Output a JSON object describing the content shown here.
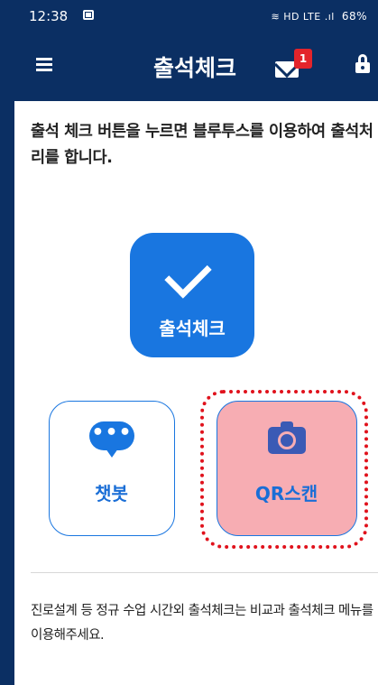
{
  "status_bar": {
    "time": "12:38",
    "network": "≋ HD LTE .ıl",
    "battery": "68%"
  },
  "app_bar": {
    "title": "출석체크",
    "mail_badge": "1"
  },
  "main": {
    "intro_text": "출석 체크 버튼을 누르면 블루투스를 이용하여 출석처리를 합니다.",
    "checkin_label": "출석체크",
    "chatbot_label": "챗봇",
    "chat_dots": "•••",
    "qr_label": "QR스캔",
    "footer_note": "진로설계 등 정규 수업 시간외 출석체크는 비교과 출석체크 메뉴를 이용해주세요."
  },
  "colors": {
    "header_bg": "#0b2f63",
    "accent_blue": "#1976e0",
    "qr_highlight_fill": "#f7adb3",
    "highlight_border": "#e0121c",
    "badge_red": "#e3242b"
  },
  "icons": [
    "menu-icon",
    "mail-icon",
    "lock-icon",
    "checkmark-icon",
    "chat-bubble-icon",
    "camera-icon"
  ]
}
